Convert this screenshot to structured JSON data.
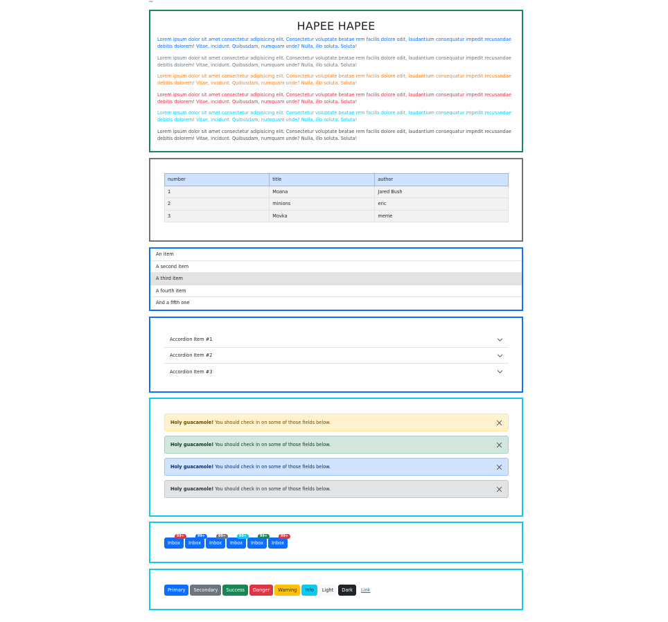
{
  "stray_mark": "~",
  "text_section": {
    "title": "HAPEE HAPEE",
    "paragraphs": [
      {
        "text": "Lorem ipsum dolor sit amet consectetur adipisicing elit. Consectetur voluptate beatae rem facilis dolore odit, laudantium consequatur impedit recusandae debitis dolorem! Vitae, incidunt. Quibusdam, numquam unde? Nulla, illo soluta. Soluta!",
        "color": "#0d6efd"
      },
      {
        "text": "Lorem ipsum dolor sit amet consectetur adipisicing elit. Consectetur voluptate beatae rem facilis dolore odit, laudantium consequatur impedit recusandae debitis dolorem! Vitae, incidunt. Quibusdam, numquam unde? Nulla, illo soluta. Soluta!",
        "color": "#6c757d"
      },
      {
        "text": "Lorem ipsum dolor sit amet consectetur adipisicing elit. Consectetur voluptate beatae rem facilis dolore odit, laudantium consequatur impedit recusandae debitis dolorem! Vitae, incidunt. Quibusdam, numquam unde? Nulla, illo soluta. Soluta!",
        "color": "#fd7e14"
      },
      {
        "text": "Lorem ipsum dolor sit amet consectetur adipisicing elit. Consectetur voluptate beatae rem facilis dolore odit, laudantium consequatur impedit recusandae debitis dolorem! Vitae, incidunt. Quibusdam, numquam unde? Nulla, illo soluta. Soluta!",
        "color": "#dc3545"
      },
      {
        "text": "Lorem ipsum dolor sit amet consectetur adipisicing elit. Consectetur voluptate beatae rem facilis dolore odit, laudantium consequatur impedit recusandae debitis dolorem! Vitae, incidunt. Quibusdam, numquam unde? Nulla, illo soluta. Soluta!",
        "color": "#0dcaf0"
      },
      {
        "text": "Lorem ipsum dolor sit amet consectetur adipisicing elit. Consectetur voluptate beatae rem facilis dolore odit, laudantium consequatur impedit recusandae debitis dolorem! Vitae, incidunt. Quibusdam, numquam unde? Nulla, illo soluta. Soluta!",
        "color": "#495057"
      }
    ]
  },
  "table": {
    "headers": [
      "number",
      "title",
      "author"
    ],
    "rows": [
      [
        "1",
        "Moana",
        "Jared Bush"
      ],
      [
        "2",
        "minions",
        "eric"
      ],
      [
        "3",
        "Movka",
        "meme"
      ]
    ]
  },
  "list": {
    "items": [
      "An item",
      "A second item",
      "A third item",
      "A fourth item",
      "And a fifth one"
    ],
    "active_index": 2
  },
  "accordion": {
    "items": [
      "Accordion Item #1",
      "Accordion Item #2",
      "Accordion Item #3"
    ]
  },
  "alerts": [
    {
      "strong": "Holy guacamole!",
      "text": "You should check in on some of those fields below.",
      "variant": "warning"
    },
    {
      "strong": "Holy guacamole!",
      "text": "You should check in on some of those fields below.",
      "variant": "success"
    },
    {
      "strong": "Holy guacamole!",
      "text": "You should check in on some of those fields below.",
      "variant": "primary"
    },
    {
      "strong": "Holy guacamole!",
      "text": "You should check in on some of those fields below.",
      "variant": "secondary"
    }
  ],
  "inbox": {
    "label": "Inbox",
    "badges": [
      {
        "text": "99+",
        "color": "#dc3545"
      },
      {
        "text": "99+",
        "color": "#0d6efd"
      },
      {
        "text": "99+",
        "color": "#6c757d"
      },
      {
        "text": "99+",
        "color": "#0dcaf0"
      },
      {
        "text": "99+",
        "color": "#198754"
      },
      {
        "text": "99+",
        "color": "#dc3545"
      }
    ]
  },
  "buttons": [
    {
      "label": "Primary",
      "color": "#0d6efd"
    },
    {
      "label": "Secondary",
      "color": "#6c757d"
    },
    {
      "label": "Success",
      "color": "#198754"
    },
    {
      "label": "Danger",
      "color": "#dc3545"
    },
    {
      "label": "Warning",
      "color": "#ffc107"
    },
    {
      "label": "Info",
      "color": "#0dcaf0"
    },
    {
      "label": "Light",
      "color": "#f8f9fa"
    },
    {
      "label": "Dark",
      "color": "#212529"
    },
    {
      "label": "Link",
      "color": "#0d6efd"
    }
  ]
}
